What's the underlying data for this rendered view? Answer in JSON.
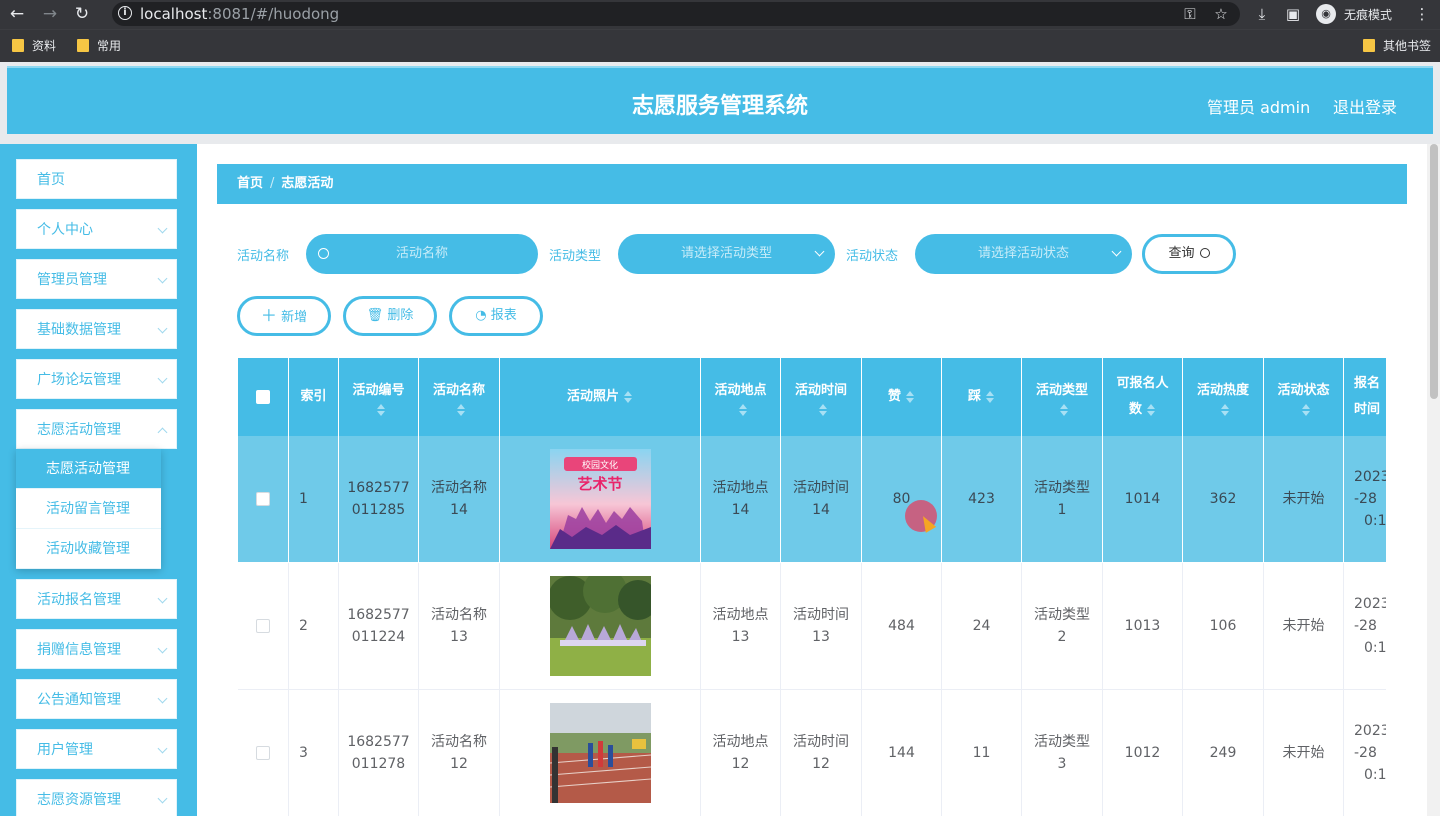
{
  "browser": {
    "url_host": "localhost",
    "url_rest": ":8081/#/huodong",
    "incognito_label": "无痕模式",
    "bookmarks": [
      "资料",
      "常用"
    ],
    "other_bookmarks": "其他书签"
  },
  "header": {
    "title": "志愿服务管理系统",
    "user": "管理员 admin",
    "logout": "退出登录"
  },
  "sidebar": {
    "items": [
      {
        "label": "首页"
      },
      {
        "label": "个人中心"
      },
      {
        "label": "管理员管理"
      },
      {
        "label": "基础数据管理"
      },
      {
        "label": "广场论坛管理"
      },
      {
        "label": "志愿活动管理"
      },
      {
        "label": "活动报名管理"
      },
      {
        "label": "捐赠信息管理"
      },
      {
        "label": "公告通知管理"
      },
      {
        "label": "用户管理"
      },
      {
        "label": "志愿资源管理"
      }
    ],
    "submenu": [
      {
        "label": "志愿活动管理"
      },
      {
        "label": "活动留言管理"
      },
      {
        "label": "活动收藏管理"
      }
    ]
  },
  "breadcrumb": {
    "home": "首页",
    "sep": "/",
    "current": "志愿活动"
  },
  "search": {
    "name_label": "活动名称",
    "name_placeholder": "活动名称",
    "type_label": "活动类型",
    "type_placeholder": "请选择活动类型",
    "status_label": "活动状态",
    "status_placeholder": "请选择活动状态",
    "query": "查询"
  },
  "actions": {
    "add": "新增",
    "delete": "删除",
    "report": "报表"
  },
  "table": {
    "headers": {
      "index": "索引",
      "code": "活动编号",
      "name": "活动名称",
      "photo": "活动照片",
      "place": "活动地点",
      "time": "活动时间",
      "like": "赞",
      "dislike": "踩",
      "type": "活动类型",
      "capacity_1": "可报名人",
      "capacity_2": "数",
      "heat": "活动热度",
      "status": "活动状态",
      "signup_1": "报名",
      "signup_2": "时间"
    },
    "rows": [
      {
        "index": "1",
        "code_1": "1682577",
        "code_2": "011285",
        "name_1": "活动名称",
        "name_2": "14",
        "photo_title": "校园文化",
        "photo_title2": "艺术节",
        "place_1": "活动地点",
        "place_2": "14",
        "time_1": "活动时间",
        "time_2": "14",
        "like": "80",
        "dislike": "423",
        "type_1": "活动类型",
        "type_2": "1",
        "capacity": "1014",
        "heat": "362",
        "status": "未开始",
        "signup_1": "2023",
        "signup_2": "-28",
        "signup_3": "0:1"
      },
      {
        "index": "2",
        "code_1": "1682577",
        "code_2": "011224",
        "name_1": "活动名称",
        "name_2": "13",
        "place_1": "活动地点",
        "place_2": "13",
        "time_1": "活动时间",
        "time_2": "13",
        "like": "484",
        "dislike": "24",
        "type_1": "活动类型",
        "type_2": "2",
        "capacity": "1013",
        "heat": "106",
        "status": "未开始",
        "signup_1": "2023",
        "signup_2": "-28",
        "signup_3": "0:1"
      },
      {
        "index": "3",
        "code_1": "1682577",
        "code_2": "011278",
        "name_1": "活动名称",
        "name_2": "12",
        "place_1": "活动地点",
        "place_2": "12",
        "time_1": "活动时间",
        "time_2": "12",
        "like": "144",
        "dislike": "11",
        "type_1": "活动类型",
        "type_2": "3",
        "capacity": "1012",
        "heat": "249",
        "status": "未开始",
        "signup_1": "2023",
        "signup_2": "-28",
        "signup_3": "0:1"
      }
    ]
  },
  "colors": {
    "accent": "#45bce6",
    "row_highlight": "#6fcae9"
  }
}
